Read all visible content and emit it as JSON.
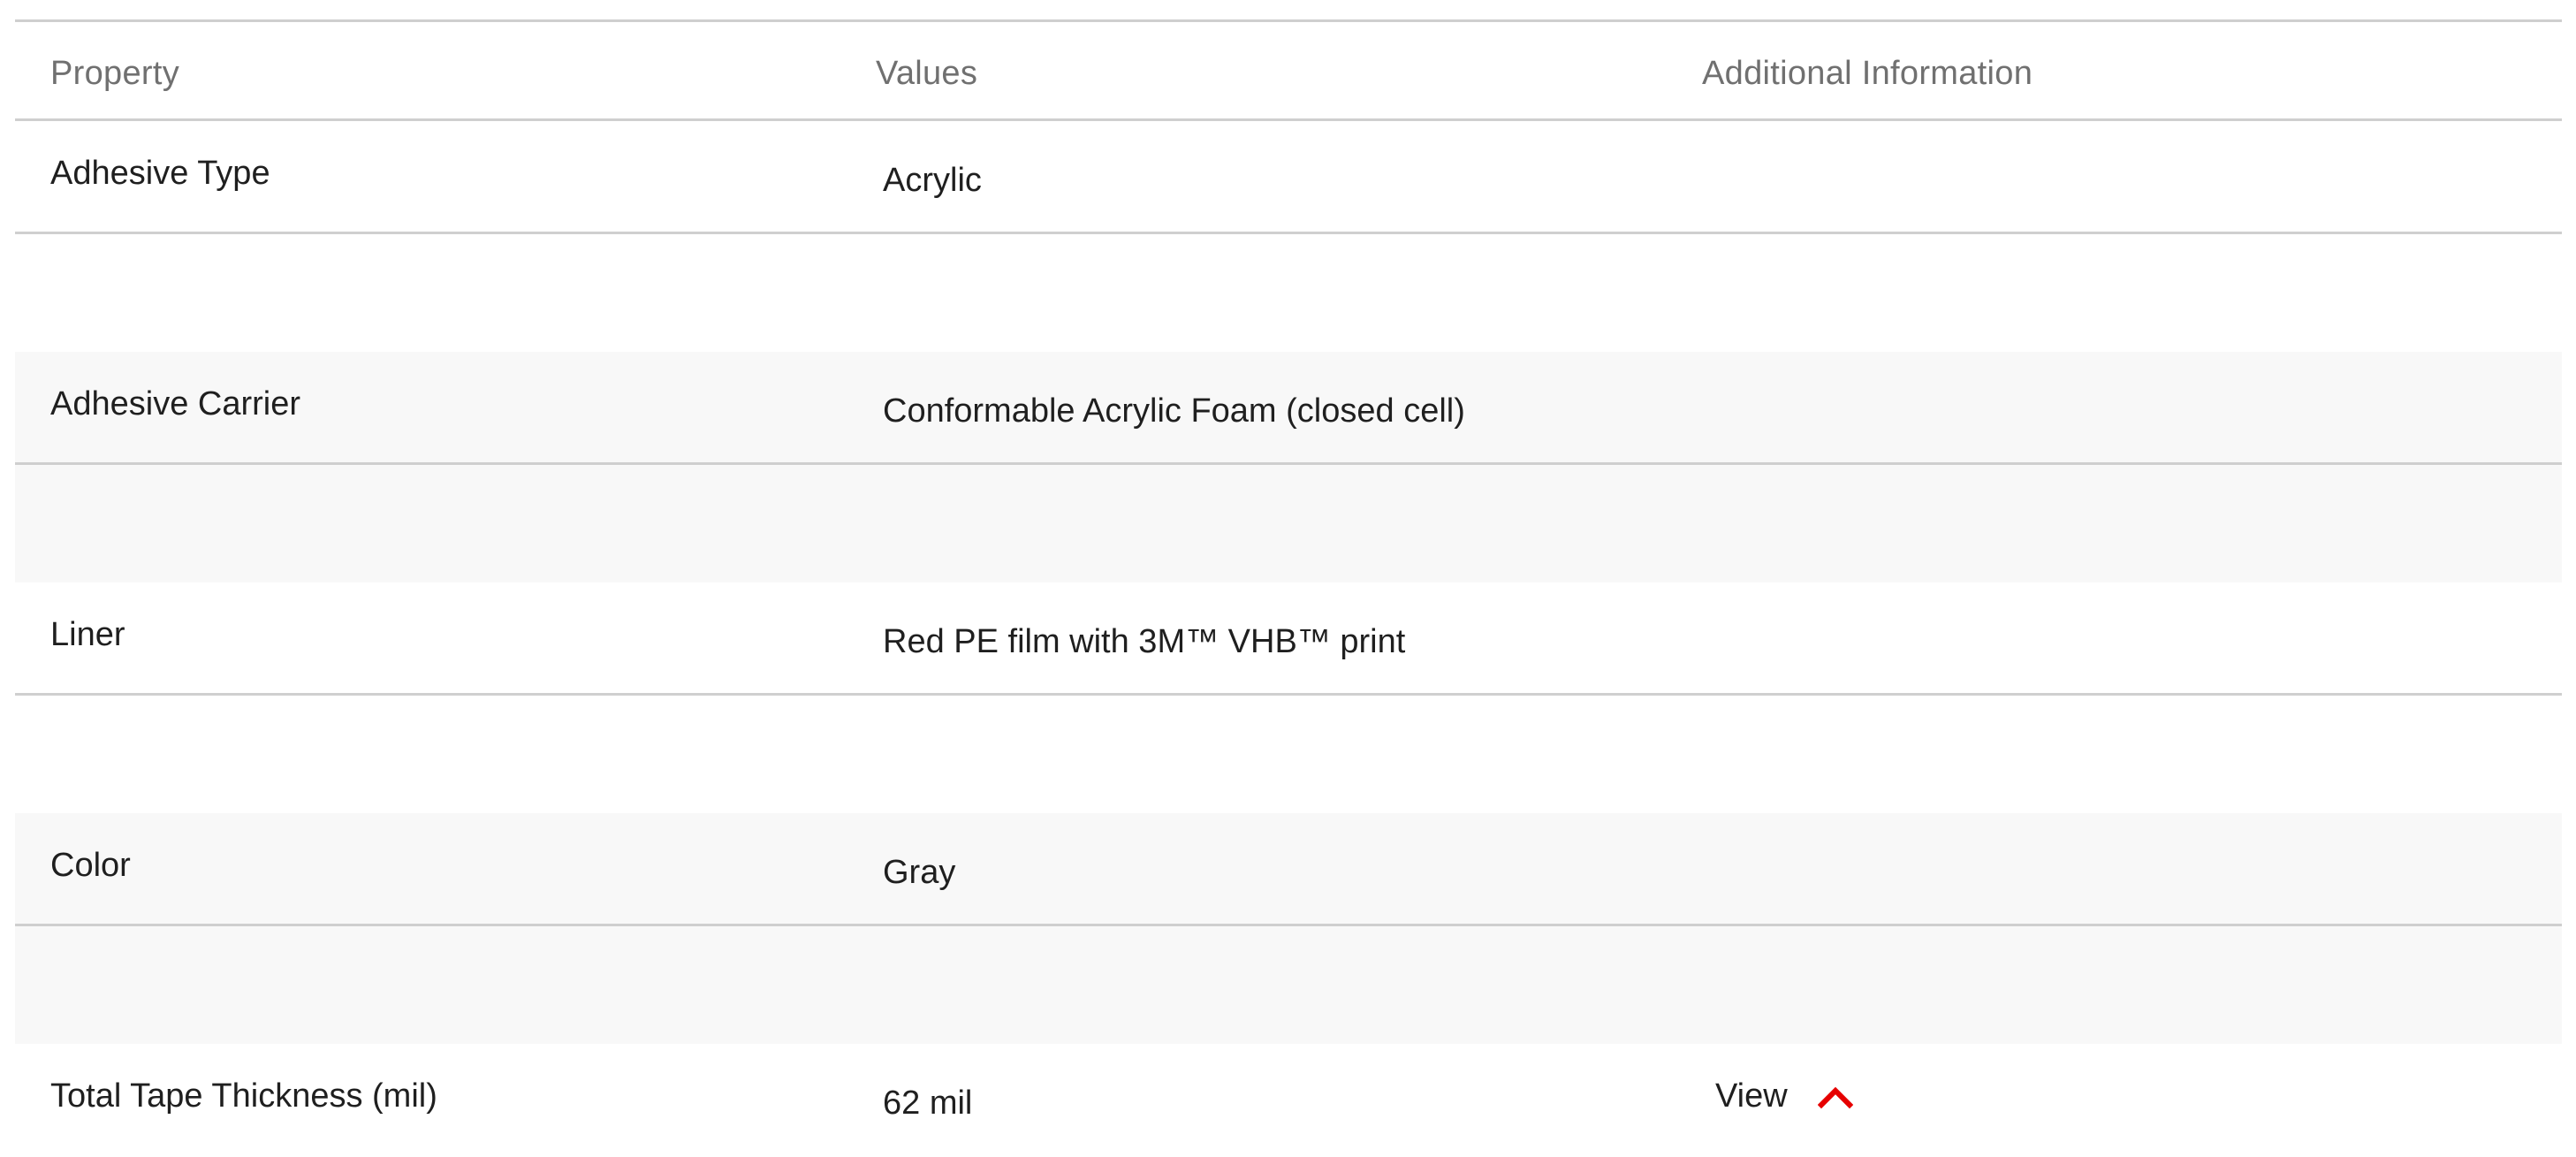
{
  "table": {
    "headers": {
      "property": "Property",
      "values": "Values",
      "additional_information": "Additional Information"
    },
    "rows": [
      {
        "property": "Adhesive Type",
        "value": "Acrylic",
        "info": ""
      },
      {
        "property": "Adhesive Carrier",
        "value": "Conformable Acrylic Foam (closed cell)",
        "info": ""
      },
      {
        "property": "Liner",
        "value": "Red PE film with 3M™ VHB™ print",
        "info": ""
      },
      {
        "property": "Color",
        "value": "Gray",
        "info": ""
      },
      {
        "property": "Total Tape Thickness (mil)",
        "value": "62 mil",
        "info": "View",
        "info_icon": "chevron-up-icon"
      }
    ]
  },
  "colors": {
    "accent": "#e60000",
    "row_shade": "#f8f8f8",
    "rule": "#cfcfcf",
    "header_text": "#707070"
  }
}
